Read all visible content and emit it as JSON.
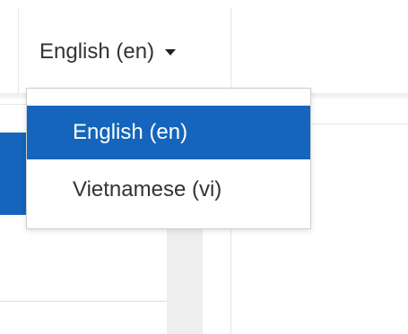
{
  "language_menu": {
    "current_label": "English (en)",
    "options": [
      {
        "label": "English (en)",
        "selected": true
      },
      {
        "label": "Vietnamese (vi)",
        "selected": false
      }
    ]
  },
  "colors": {
    "accent": "#1465bb",
    "text": "#333333"
  }
}
